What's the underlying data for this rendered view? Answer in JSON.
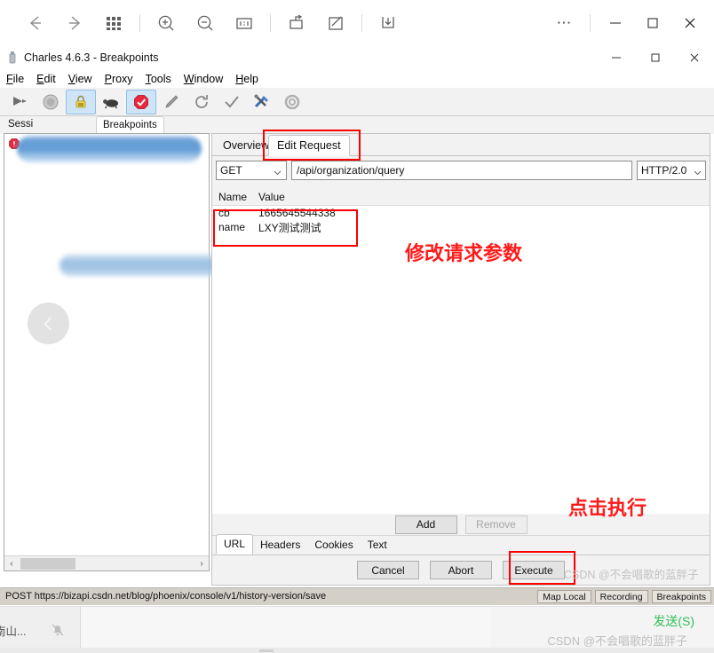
{
  "host_toolbar": {
    "icons": [
      {
        "name": "back-arrow-icon",
        "label": "Back"
      },
      {
        "name": "forward-arrow-icon",
        "label": "Forward"
      },
      {
        "name": "grid-view-icon",
        "label": "Grid"
      },
      {
        "name": "zoom-in-icon",
        "label": "Zoom In"
      },
      {
        "name": "zoom-out-icon",
        "label": "Zoom Out"
      },
      {
        "name": "fit-width-icon",
        "label": "Actual Size"
      },
      {
        "name": "new-window-icon",
        "label": "New Window"
      },
      {
        "name": "edit-icon",
        "label": "Edit"
      },
      {
        "name": "download-icon",
        "label": "Save"
      }
    ],
    "more_label": "⋯",
    "minimize_label": "—",
    "maximize_label": "☐",
    "close_label": "✕"
  },
  "charles_window": {
    "title": "Charles 4.6.3 - Breakpoints",
    "app_icon": "charles-bottle-icon",
    "minimize_label": "—",
    "maximize_label": "☐",
    "close_label": "✕"
  },
  "menubar": {
    "items": [
      {
        "pre": "",
        "mnemonic": "F",
        "post": "ile"
      },
      {
        "pre": "",
        "mnemonic": "E",
        "post": "dit"
      },
      {
        "pre": "",
        "mnemonic": "V",
        "post": "iew"
      },
      {
        "pre": "",
        "mnemonic": "P",
        "post": "roxy"
      },
      {
        "pre": "",
        "mnemonic": "T",
        "post": "ools"
      },
      {
        "pre": "",
        "mnemonic": "W",
        "post": "indow"
      },
      {
        "pre": "",
        "mnemonic": "H",
        "post": "elp"
      }
    ]
  },
  "charles_toolbar": {
    "items": [
      {
        "name": "clear-session-icon",
        "label": "Clear the current session",
        "active": false
      },
      {
        "name": "record-icon",
        "label": "Start/Stop Recording",
        "active": false
      },
      {
        "name": "ssl-proxying-icon",
        "label": "Enable SSL Proxying",
        "active": true
      },
      {
        "name": "throttle-turtle-icon",
        "label": "Start/Stop Throttling",
        "active": false
      },
      {
        "name": "breakpoint-stop-icon",
        "label": "Enable/Disable Breakpoints",
        "active": true
      },
      {
        "name": "compose-icon",
        "label": "Compose a new request",
        "active": false
      },
      {
        "name": "repeat-icon",
        "label": "Repeat the request",
        "active": false
      },
      {
        "name": "validate-icon",
        "label": "Validate the recording",
        "active": false
      },
      {
        "name": "tools-icon",
        "label": "Tools",
        "active": false
      },
      {
        "name": "settings-gear-icon",
        "label": "Settings",
        "active": false
      }
    ]
  },
  "tabstrip": {
    "session_tab": "Sessi",
    "breakpoints_tab": "Breakpoints"
  },
  "left_panel": {
    "rows": [
      {
        "badge": "breakpoint-icon",
        "redacted": true
      }
    ],
    "collapse_button": "collapse-left-chevron-icon",
    "scroll_left": "‹",
    "scroll_right": "›"
  },
  "detail": {
    "tabs": [
      {
        "label": "Overview",
        "selected": false
      },
      {
        "label": "Edit Request",
        "selected": true
      }
    ],
    "request": {
      "method": "GET",
      "path": "/api/organization/query",
      "version": "HTTP/2.0",
      "caret": "⌄"
    },
    "params_table": {
      "columns": [
        "Name",
        "Value"
      ],
      "rows": [
        {
          "name": "cb",
          "value": "1665645544338"
        },
        {
          "name": "name",
          "value": "LXY测试测试"
        }
      ]
    },
    "row_buttons": [
      {
        "label": "Add",
        "disabled": false
      },
      {
        "label": "Remove",
        "disabled": true
      }
    ],
    "sub_tabs": [
      {
        "label": "URL",
        "selected": true
      },
      {
        "label": "Headers",
        "selected": false
      },
      {
        "label": "Cookies",
        "selected": false
      },
      {
        "label": "Text",
        "selected": false
      }
    ],
    "action_buttons": [
      {
        "label": "Cancel",
        "disabled": false
      },
      {
        "label": "Abort",
        "disabled": false
      },
      {
        "label": "Execute",
        "disabled": false
      }
    ]
  },
  "annotations": [
    {
      "name": "annotation-modify-params",
      "text": "修改请求参数",
      "color": "#ff1a1a"
    },
    {
      "name": "annotation-click-execute",
      "text": "点击执行",
      "color": "#ff1a1a"
    }
  ],
  "status_bar": {
    "text": "POST https://bizapi.csdn.net/blog/phoenix/console/v1/history-version/save",
    "buttons": [
      "Map Local",
      "Recording",
      "Breakpoints"
    ]
  },
  "host_bottom": {
    "app_name": "南山...",
    "bell_icon": "bell-muted-icon",
    "send_label": "发送(S)"
  },
  "watermarks": {
    "top": "CSDN @不会唱歌的蓝胖子",
    "bottom": "CSDN @不会唱歌的蓝胖子"
  },
  "colors": {
    "annotation_red": "#ff1a1a",
    "send_green": "#2fbf55",
    "tab_active_bg": "#cfe4f7"
  }
}
